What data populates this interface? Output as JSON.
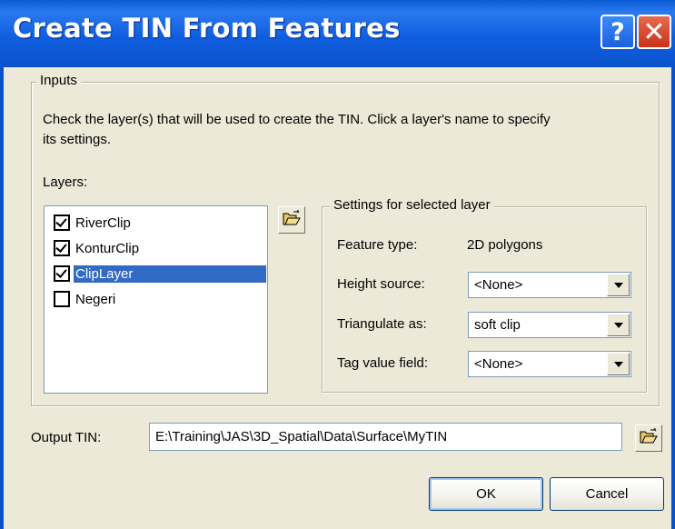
{
  "window": {
    "title": "Create TIN From Features",
    "help_glyph": "?",
    "close_glyph": "✕"
  },
  "inputs": {
    "legend": "Inputs",
    "instructions_line1": "Check the layer(s) that will be used to create the TIN.  Click a layer's name to specify",
    "instructions_line2": "its settings.",
    "layers_label": "Layers:",
    "layers": [
      {
        "name": "RiverClip",
        "checked": true,
        "selected": false
      },
      {
        "name": "KonturClip",
        "checked": true,
        "selected": false
      },
      {
        "name": "ClipLayer",
        "checked": true,
        "selected": true
      },
      {
        "name": "Negeri",
        "checked": false,
        "selected": false
      }
    ]
  },
  "settings": {
    "legend": "Settings for selected layer",
    "feature_type_label": "Feature type:",
    "feature_type_value": "2D polygons",
    "height_source_label": "Height source:",
    "height_source_value": "<None>",
    "triangulate_label": "Triangulate as:",
    "triangulate_value": "soft clip",
    "tag_value_label": "Tag value field:",
    "tag_value_value": "<None>"
  },
  "output": {
    "label": "Output TIN:",
    "value": "E:\\Training\\JAS\\3D_Spatial\\Data\\Surface\\MyTIN"
  },
  "buttons": {
    "ok": "OK",
    "cancel": "Cancel"
  },
  "icons": {
    "add_layer": "open-folder-icon",
    "browse_output": "open-folder-icon"
  },
  "colors": {
    "title_bar": "#0a52cc",
    "selection": "#316ac5",
    "dialog_bg": "#ece9d8"
  }
}
